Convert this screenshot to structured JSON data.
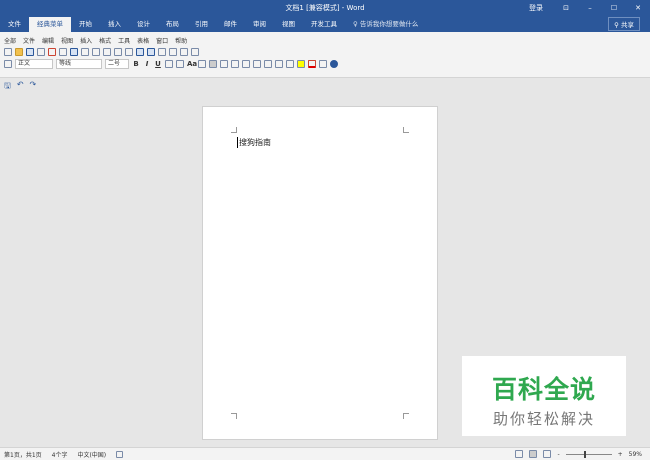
{
  "window": {
    "title": "文档1 [兼容模式] - Word",
    "login": "登录",
    "ribbon_display": "⊡",
    "minimize": "–",
    "maximize": "☐",
    "close": "✕"
  },
  "tabs": [
    "文件",
    "经典菜单",
    "开始",
    "插入",
    "设计",
    "布局",
    "引用",
    "邮件",
    "审阅",
    "视图",
    "开发工具"
  ],
  "tell_me": "告诉我你想要做什么",
  "share": "共享",
  "menu": [
    "全部",
    "文件",
    "编辑",
    "视图",
    "插入",
    "格式",
    "工具",
    "表格",
    "窗口",
    "帮助"
  ],
  "format": {
    "style": "正文",
    "font": "等线",
    "size": "二号",
    "bold": "B",
    "italic": "I",
    "underline": "U",
    "case": "Aa"
  },
  "qat": {
    "save": "🖫",
    "undo": "↶",
    "redo": "↷"
  },
  "document": {
    "text": "搜狗指南"
  },
  "status": {
    "page": "第1页，共1页",
    "words": "4个字",
    "language": "中文(中国)",
    "zoom": "59%",
    "zoom_value": 59
  },
  "watermark": {
    "line1": "百科全说",
    "line2": "助你轻松解决"
  }
}
